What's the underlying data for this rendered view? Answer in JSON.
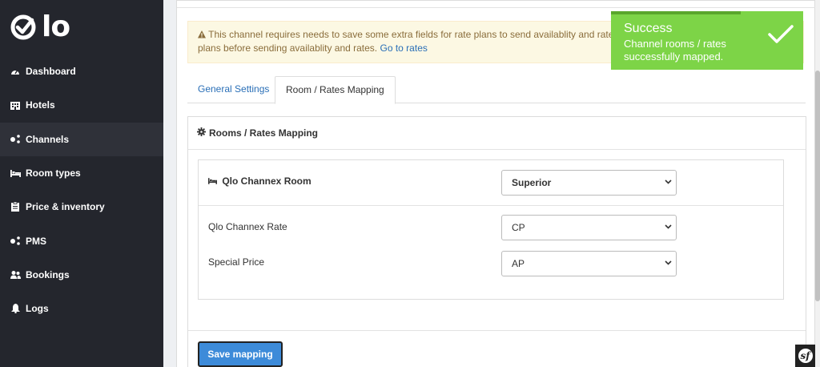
{
  "logo": {
    "text": "lo"
  },
  "sidebar": {
    "items": [
      {
        "label": "Dashboard",
        "icon": "dashboard-icon"
      },
      {
        "label": "Hotels",
        "icon": "building-icon"
      },
      {
        "label": "Channels",
        "icon": "share-nodes-icon"
      },
      {
        "label": "Room types",
        "icon": "bed-icon"
      },
      {
        "label": "Price & inventory",
        "icon": "clipboard-icon"
      },
      {
        "label": "PMS",
        "icon": "share-nodes-icon"
      },
      {
        "label": "Bookings",
        "icon": "users-icon"
      },
      {
        "label": "Logs",
        "icon": "bell-icon"
      }
    ],
    "active": "Channels"
  },
  "warning": {
    "text": "This channel requires needs to save some extra fields for rate plans to send availablity and rates to th",
    "text2": "plans before sending availablity and rates.",
    "link": "Go to rates"
  },
  "tabs": [
    {
      "label": "General Settings"
    },
    {
      "label": "Room / Rates Mapping"
    }
  ],
  "card": {
    "title": "Rooms / Rates Mapping",
    "room_label": "Qlo Channex Room",
    "room_value": "Superior",
    "rate_label": "Qlo Channex Rate",
    "rate_value": "CP",
    "special_label": "Special Price",
    "special_value": "AP",
    "save_label": "Save mapping"
  },
  "toast": {
    "title": "Success",
    "message": "Channel rooms / rates successfully mapped."
  },
  "colors": {
    "sidebar_bg": "#24262d",
    "toast_bg": "#7dd447",
    "primary": "#3d8bd9",
    "link": "#2a6fb7"
  }
}
